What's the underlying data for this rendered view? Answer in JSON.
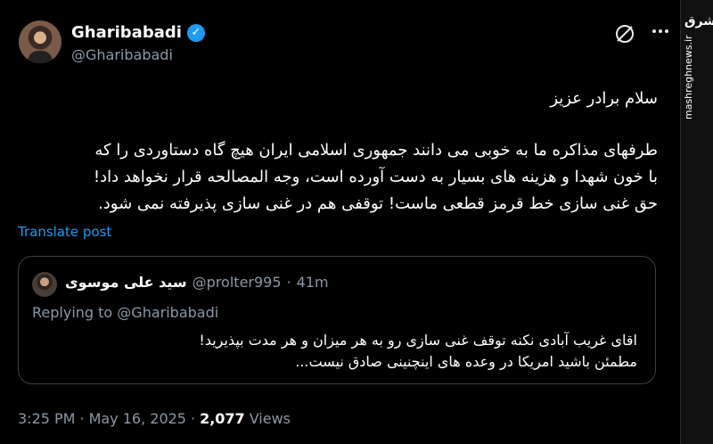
{
  "brand": {
    "logo_text": "مشرق",
    "url": "mashreghnews.ir"
  },
  "author": {
    "name": "Gharibabadi",
    "handle": "@Gharibabadi"
  },
  "post": {
    "greeting": "سلام برادر عزیز",
    "body_line1": "طرفهای مذاکره ما به خوبی می دانند جمهوری اسلامی ایران هیچ گاه دستاوردی را که",
    "body_line2": "با خون شهدا و هزینه های بسیار به دست آورده است، وجه المصالحه قرار نخواهد داد!",
    "body_line3": "حق غنی سازی خط قرمز قطعی ماست! توقفی هم در غنی سازی پذیرفته نمی شود.",
    "translate_label": "Translate post"
  },
  "quote": {
    "name": "سید علی موسوی",
    "handle": "@prolter995",
    "separator": "·",
    "time": "41m",
    "replying_to": "Replying to @Gharibabadi",
    "line1": "اقای غریب آبادی نکنه توقف غنی سازی رو به هر میزان و هر مدت بپذیرید!",
    "line2": "مطمئن باشید امریکا در وعده های اینچنینی صادق نیست..."
  },
  "meta": {
    "time": "3:25 PM",
    "sep1": "·",
    "date": "May 16, 2025",
    "sep2": "·",
    "views_count": "2,077",
    "views_label": "Views"
  },
  "colors": {
    "background": "#000000",
    "accent": "#1d9bf0",
    "muted": "#8b98a5"
  }
}
